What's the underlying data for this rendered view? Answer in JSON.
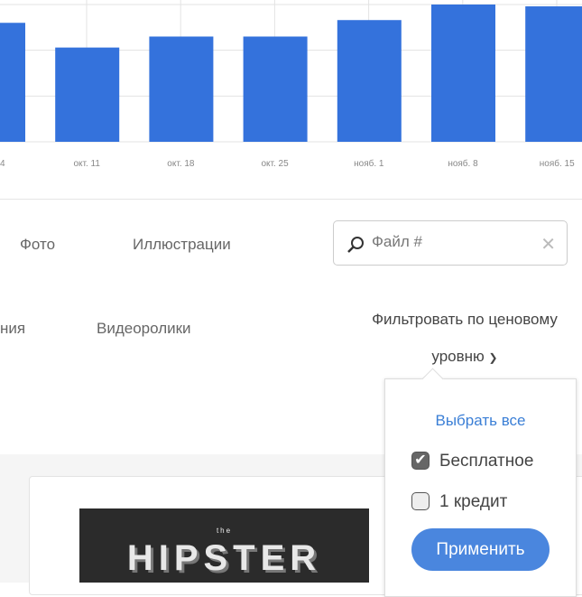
{
  "chart_data": {
    "type": "bar",
    "categories": [
      "4",
      "окт. 11",
      "окт. 18",
      "окт. 25",
      "нояб. 1",
      "нояб. 8",
      "нояб. 15"
    ],
    "values": [
      130,
      103,
      115,
      115,
      133,
      150,
      148
    ],
    "ylim": [
      0,
      150
    ],
    "color": "#3472dc",
    "grid": true
  },
  "tabs": {
    "photo": "Фото",
    "illustrations": "Иллюстрации",
    "partial": "ния",
    "videos": "Видеоролики"
  },
  "search": {
    "placeholder": "Файл #"
  },
  "filter": {
    "line1": "Фильтровать по ценовому",
    "line2": "уровню"
  },
  "popover": {
    "select_all": "Выбрать все",
    "options": [
      {
        "label": "Бесплатное",
        "checked": true
      },
      {
        "label": "1 кредит",
        "checked": false
      }
    ],
    "apply": "Применить"
  },
  "thumbnail": {
    "small": "the",
    "title": "HIPSTER"
  }
}
